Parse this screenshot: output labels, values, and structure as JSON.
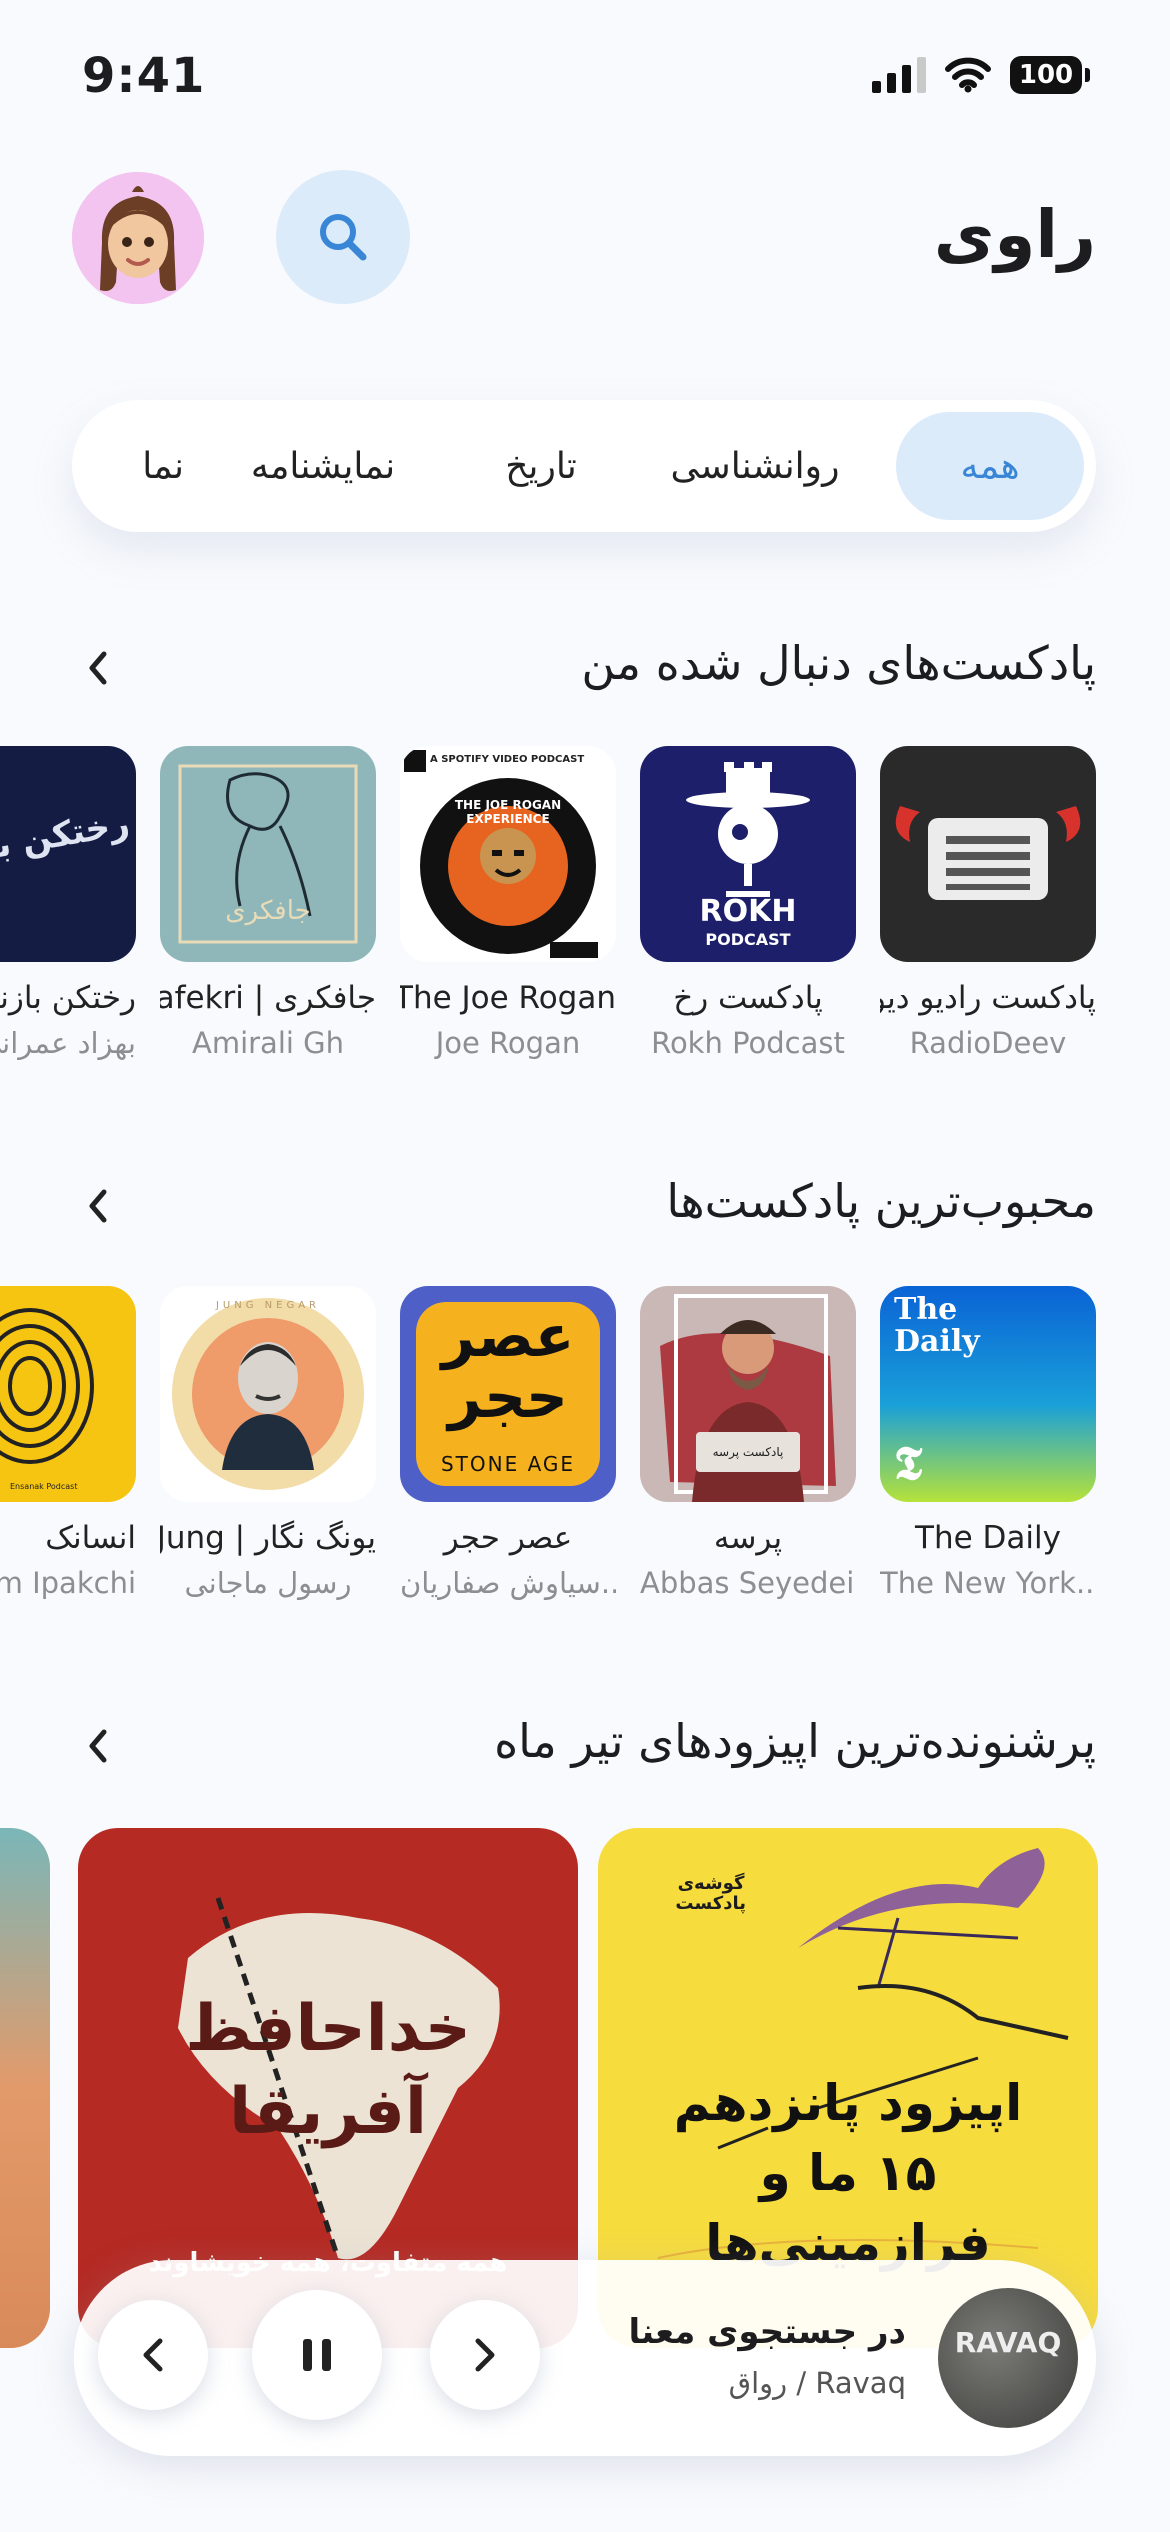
{
  "status_bar": {
    "time": "9:41",
    "battery": "100"
  },
  "header": {
    "title": "راوی"
  },
  "tabs": [
    {
      "label": "همه",
      "active": true
    },
    {
      "label": "روانشناسی"
    },
    {
      "label": "تاریخ"
    },
    {
      "label": "نمایشنامه"
    },
    {
      "label": "نما"
    }
  ],
  "sections": {
    "followed": {
      "title": "پادکست‌های دنبال شده من",
      "items": [
        {
          "title": "پادکست رادیو دیو",
          "subtitle": "RadioDeev",
          "art_text": ""
        },
        {
          "title": "پادکست رخ",
          "subtitle": "Rokh Podcast",
          "art_text": "ROKH",
          "art_text2": "PODCAST"
        },
        {
          "title": "The Joe Rogan",
          "subtitle": "Joe Rogan",
          "art_text": "A SPOTIFY VIDEO PODCAST",
          "art_text2": "THE JOE ROGAN EXPERIENCE"
        },
        {
          "title": "جافکری | Jafekri",
          "subtitle": "Amirali Gh",
          "art_text": "جافکری"
        },
        {
          "title": "رختکن بازند",
          "subtitle": "بهزاد عمرانی",
          "art_text": "رختکن بازنده"
        }
      ]
    },
    "popular": {
      "title": "محبوب‌ترین پادکست‌ها",
      "items": [
        {
          "title": "The Daily",
          "subtitle": "The New York...",
          "art_text": "The Daily"
        },
        {
          "title": "پرسه",
          "subtitle": "Abbas Seyedein",
          "art_text": "پادکست پرسه"
        },
        {
          "title": "عصر حجر",
          "subtitle": "سیاوش صفاریان...",
          "art_text": "عصر حجر",
          "art_text2": "STONE AGE"
        },
        {
          "title": "یونگ نگار | Jung...",
          "subtitle": "رسول ماجانی",
          "art_text": "JUNG NEGAR"
        },
        {
          "title": "انسانک",
          "subtitle": "m Ipakchi",
          "art_text": "Ensanak Podcast"
        }
      ]
    },
    "episodes": {
      "title": "پرشنونده‌ترین اپیزودهای تیر ماه",
      "items": [
        {
          "title": "اپیزود پانزدهم ۱۵ ما و فرازمینی‌ها",
          "art_text": "گوشه‌ی پادکست"
        },
        {
          "title": "خداحافظ آفریقا",
          "art_text": "همه متفاوت، همه خویشاوند"
        },
        {
          "title": "",
          "art_text": ""
        }
      ]
    }
  },
  "player": {
    "title": "در جستجوی معنا",
    "subtitle": "رواق / Ravaq",
    "cover_text": "RAVAQ"
  },
  "icons": {
    "search": "search-icon",
    "chevron": "chevron-left-icon",
    "pause": "pause-icon",
    "prev": "previous-icon",
    "next": "next-icon"
  },
  "colors": {
    "accent": "#3a86d6",
    "accent_bg": "#dcebfa"
  }
}
